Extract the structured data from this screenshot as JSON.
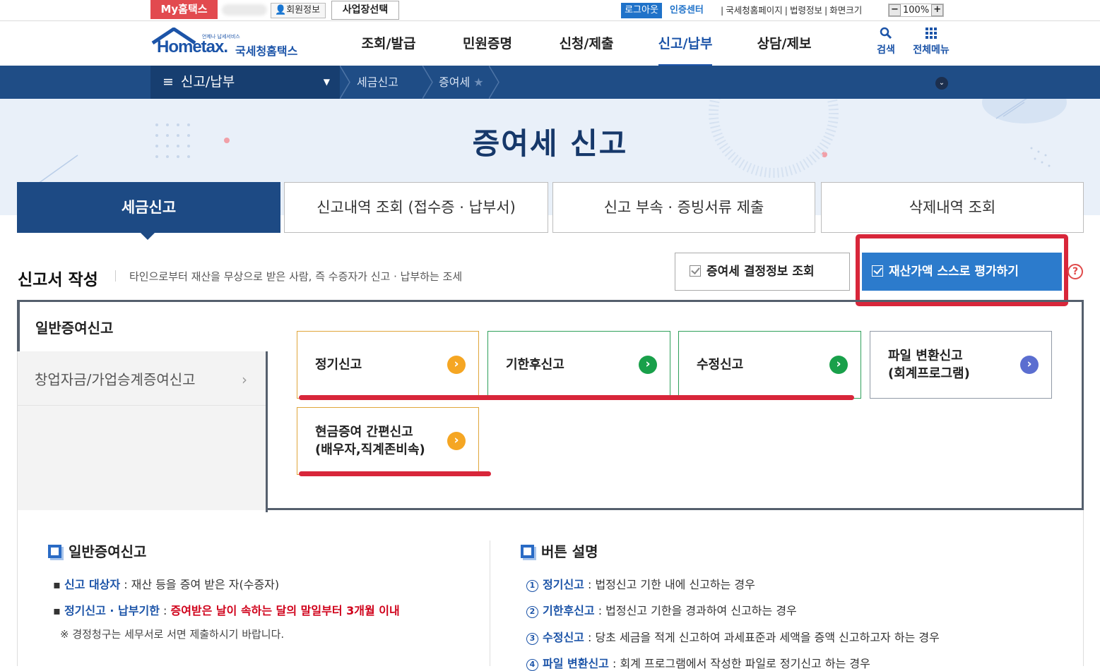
{
  "topbar": {
    "my_hometax": "My홈택스",
    "member_info": "회원정보",
    "business_select": "사업장선택",
    "logout": "로그아웃",
    "cert_center": "인증센터",
    "links": [
      "국세청홈페이지",
      "법령정보",
      "화면크기"
    ],
    "zoom": "100%",
    "zoom_minus": "−",
    "zoom_plus": "+"
  },
  "header": {
    "logo_main": "Hometax.",
    "logo_sub": "국세청홈택스",
    "logo_tiny": "언제나 납세서비스",
    "nav": [
      "조회/발급",
      "민원증명",
      "신청/제출",
      "신고/납부",
      "상담/제보"
    ],
    "active_nav": "신고/납부",
    "search_label": "검색",
    "menu_label": "전체메뉴"
  },
  "breadcrumb": {
    "root": "신고/납부",
    "items": [
      "세금신고",
      "증여세"
    ]
  },
  "hero": {
    "title": "증여세 신고"
  },
  "tabs": [
    "세금신고",
    "신고내역 조회 (접수증 · 납부서)",
    "신고 부속 · 증빙서류 제출",
    "삭제내역 조회"
  ],
  "section": {
    "title": "신고서 작성",
    "desc": "타인으로부터 재산을 무상으로 받은 사람, 즉 수증자가 신고 · 납부하는 조세",
    "btn_decision": "증여세 결정정보 조회",
    "btn_asset": "재산가액 스스로 평가하기",
    "help": "?"
  },
  "side_menu": {
    "active": "일반증여신고",
    "items": [
      "창업자금/가업승계증여신고"
    ]
  },
  "cards": [
    {
      "line1": "정기신고",
      "line2": ""
    },
    {
      "line1": "기한후신고",
      "line2": ""
    },
    {
      "line1": "수정신고",
      "line2": ""
    },
    {
      "line1": "파일 변환신고",
      "line2": "(회계프로그램)"
    },
    {
      "line1": "현금증여 간편신고",
      "line2": "(배우자,직계존비속)"
    }
  ],
  "colors": {
    "navy": "#1d4a84",
    "accent_blue": "#2c7bcc",
    "highlight_red": "#d8263a",
    "circle_yellow": "#f5a623",
    "circle_green": "#19a04a",
    "circle_purple": "#5b6ed0"
  },
  "info_left": {
    "heading": "일반증여신고",
    "target_label": "신고 대상자",
    "target_text": " : 재산 등을 증여 받은 자(수증자)",
    "deadline_label": "정기신고 · 납부기한",
    "deadline_text": "증여받은 날이 속하는 달의 말일부터 3개월 이내",
    "note": "※ 경정청구는 세무서로 서면 제출하시기 바랍니다."
  },
  "info_right": {
    "heading": "버튼 설명",
    "items": [
      {
        "num": "1",
        "label": "정기신고",
        "text": " : 법정신고 기한 내에 신고하는 경우"
      },
      {
        "num": "2",
        "label": "기한후신고",
        "text": " : 법정신고 기한을 경과하여 신고하는 경우"
      },
      {
        "num": "3",
        "label": "수정신고",
        "text": " : 당초 세금을 적게 신고하여 과세표준과 세액을 증액 신고하고자 하는 경우"
      },
      {
        "num": "4",
        "label": "파일 변환신고",
        "text": " : 회계 프로그램에서 작성한 파일로 정기신고 하는 경우"
      }
    ]
  }
}
